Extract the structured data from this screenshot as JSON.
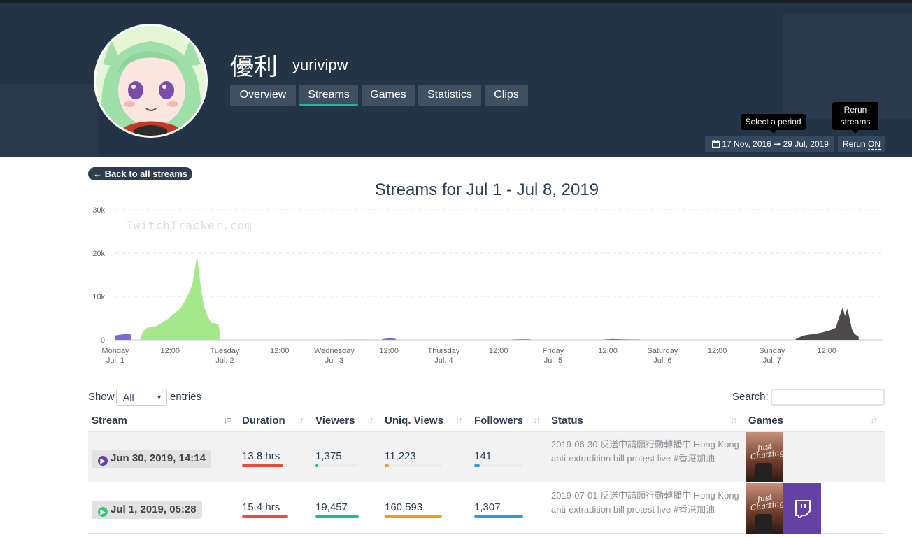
{
  "channel": {
    "display_name": "優利",
    "login": "yurivipw"
  },
  "tabs": [
    {
      "label": "Overview"
    },
    {
      "label": "Streams"
    },
    {
      "label": "Games"
    },
    {
      "label": "Statistics"
    },
    {
      "label": "Clips"
    }
  ],
  "period": {
    "tooltip": "Select a period",
    "start": "17 Nov, 2016",
    "end": "29 Jul, 2019",
    "arrow": "➞"
  },
  "rerun": {
    "tooltip_line1": "Rerun",
    "tooltip_line2": "streams",
    "label": "Rerun",
    "state": "ON"
  },
  "back_button": "← Back to all streams",
  "page_title": "Streams for Jul 1 - Jul 8, 2019",
  "chart_data": {
    "type": "area",
    "title": "Streams for Jul 1 - Jul 8, 2019",
    "watermark": "TwitchTracker.com",
    "y_ticks": [
      "0",
      "10k",
      "20k",
      "30k"
    ],
    "ylim": [
      0,
      30000
    ],
    "grid": true,
    "x_ticks": [
      {
        "hour": 0,
        "line1": "Monday",
        "line2": "Jul. 1"
      },
      {
        "hour": 12,
        "line1": "12:00",
        "line2": ""
      },
      {
        "hour": 24,
        "line1": "Tuesday",
        "line2": "Jul. 2"
      },
      {
        "hour": 36,
        "line1": "12:00",
        "line2": ""
      },
      {
        "hour": 48,
        "line1": "Wednesday",
        "line2": "Jul. 3"
      },
      {
        "hour": 60,
        "line1": "12:00",
        "line2": ""
      },
      {
        "hour": 72,
        "line1": "Thursday",
        "line2": "Jul. 4"
      },
      {
        "hour": 84,
        "line1": "12:00",
        "line2": ""
      },
      {
        "hour": 96,
        "line1": "Friday",
        "line2": "Jul. 5"
      },
      {
        "hour": 108,
        "line1": "12:00",
        "line2": ""
      },
      {
        "hour": 120,
        "line1": "Saturday",
        "line2": "Jul. 6"
      },
      {
        "hour": 132,
        "line1": "12:00",
        "line2": ""
      },
      {
        "hour": 144,
        "line1": "Sunday",
        "line2": "Jul. 7"
      },
      {
        "hour": 156,
        "line1": "12:00",
        "line2": ""
      }
    ],
    "series": [
      {
        "color": "#7b68d6",
        "points": [
          [
            0,
            1000
          ],
          [
            1,
            1200
          ],
          [
            2,
            1300
          ],
          [
            3,
            1300
          ],
          [
            3.4,
            1200
          ]
        ]
      },
      {
        "color": "#a5e88c",
        "points": [
          [
            5.5,
            500
          ],
          [
            6,
            1800
          ],
          [
            7,
            2800
          ],
          [
            8,
            3000
          ],
          [
            9,
            3200
          ],
          [
            10,
            3800
          ],
          [
            11,
            4500
          ],
          [
            12,
            5200
          ],
          [
            13,
            6200
          ],
          [
            14,
            7000
          ],
          [
            15,
            8500
          ],
          [
            16,
            10500
          ],
          [
            16.8,
            12500
          ],
          [
            17.4,
            16000
          ],
          [
            17.9,
            19500
          ],
          [
            18.4,
            15000
          ],
          [
            18.9,
            11000
          ],
          [
            19.5,
            7500
          ],
          [
            20.2,
            5500
          ],
          [
            21,
            4000
          ],
          [
            21.8,
            3800
          ],
          [
            22.6,
            3500
          ],
          [
            23,
            700
          ]
        ]
      },
      {
        "color": "#b9b2e8",
        "points": [
          [
            49,
            50
          ],
          [
            52,
            100
          ],
          [
            55,
            100
          ],
          [
            56,
            50
          ]
        ]
      },
      {
        "color": "#7b68d6",
        "points": [
          [
            58.5,
            150
          ],
          [
            59.5,
            300
          ],
          [
            60.5,
            350
          ],
          [
            61.5,
            200
          ]
        ]
      },
      {
        "color": "#7b68d6",
        "points": [
          [
            87,
            80
          ],
          [
            89,
            120
          ],
          [
            91,
            100
          ]
        ]
      },
      {
        "color": "#e8e08c",
        "points": [
          [
            102,
            50
          ],
          [
            104,
            80
          ],
          [
            106,
            60
          ]
        ]
      },
      {
        "color": "#7b68d6",
        "points": [
          [
            107,
            60
          ],
          [
            109,
            200
          ],
          [
            111,
            120
          ],
          [
            113,
            80
          ],
          [
            115,
            60
          ]
        ]
      },
      {
        "color": "#4e4a4a",
        "points": [
          [
            149.2,
            200
          ],
          [
            150,
            600
          ],
          [
            151,
            1000
          ],
          [
            152,
            1200
          ],
          [
            153,
            1300
          ],
          [
            154,
            1500
          ],
          [
            155,
            1700
          ],
          [
            156,
            2000
          ],
          [
            157,
            2300
          ],
          [
            158,
            2800
          ],
          [
            158.5,
            4500
          ],
          [
            159,
            6000
          ],
          [
            159.5,
            7500
          ],
          [
            160,
            5500
          ],
          [
            160.5,
            7200
          ],
          [
            161,
            5000
          ],
          [
            161.5,
            2500
          ],
          [
            162,
            1500
          ],
          [
            163,
            700
          ]
        ]
      }
    ]
  },
  "table": {
    "show_label": "Show",
    "show_value": "All",
    "entries_label": "entries",
    "search_label": "Search:",
    "columns": [
      "Stream",
      "Duration",
      "Viewers",
      "Uniq. Views",
      "Followers",
      "Status",
      "Games"
    ],
    "bar_colors": {
      "duration": "#e74c3c",
      "viewers": "#18bc9c",
      "uniq": "#f39c12",
      "followers": "#3498db"
    },
    "rows": [
      {
        "date": "Jun 30, 2019, 14:14",
        "dot_color": "#6441a5",
        "duration": "13.8 hrs",
        "duration_pct": 0.9,
        "viewers": "1,375",
        "viewers_pct": 0.07,
        "uniq": "11,223",
        "uniq_pct": 0.07,
        "followers": "141",
        "followers_pct": 0.11,
        "status": "2019-06-30 反送中請願行動轉播中 Hong Kong anti-extradition bill protest live #香港加油",
        "game": "Just Chatting",
        "twitch_icon": false
      },
      {
        "date": "Jul 1, 2019, 05:28",
        "dot_color": "#2ecc71",
        "duration": "15.4 hrs",
        "duration_pct": 1.0,
        "viewers": "19,457",
        "viewers_pct": 1.0,
        "uniq": "160,593",
        "uniq_pct": 1.0,
        "followers": "1,307",
        "followers_pct": 1.0,
        "status": "2019-07-01 反送中請願行動轉播中 Hong Kong anti-extradition bill protest live #香港加油",
        "game": "Just Chatting",
        "twitch_icon": true
      }
    ]
  }
}
